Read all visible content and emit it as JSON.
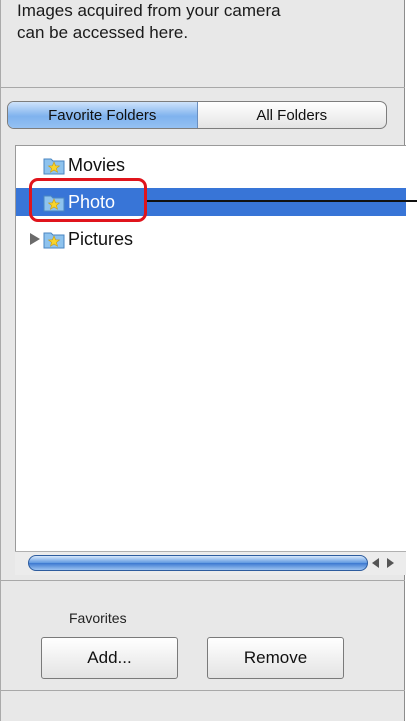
{
  "hint": {
    "line1": "Images acquired from your camera",
    "line2": "can be accessed here."
  },
  "tabs": [
    {
      "label": "Favorite Folders",
      "active": true
    },
    {
      "label": "All Folders",
      "active": false
    }
  ],
  "folders": [
    {
      "label": "Movies",
      "icon": "star-folder-icon",
      "selected": false,
      "expandable": false
    },
    {
      "label": "Photo",
      "icon": "star-folder-icon",
      "selected": true,
      "expandable": false
    },
    {
      "label": "Pictures",
      "icon": "star-folder-icon",
      "selected": false,
      "expandable": true
    }
  ],
  "favorites": {
    "label": "Favorites",
    "add_label": "Add...",
    "remove_label": "Remove"
  },
  "colors": {
    "selection": "#3875d7",
    "callout": "#e0141c"
  }
}
